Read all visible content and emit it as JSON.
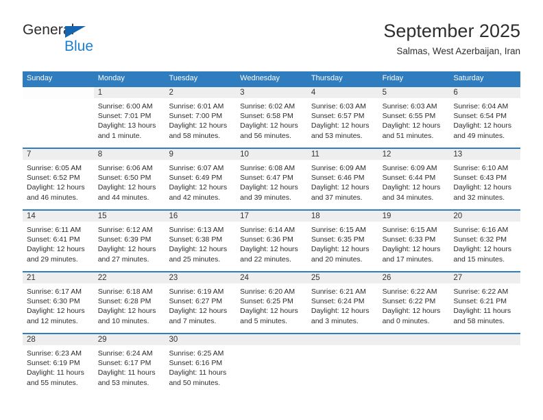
{
  "brand": {
    "name_part1": "General",
    "name_part2": "Blue",
    "triangle_icon": "triangle-icon",
    "color_dark": "#2b2b2b",
    "color_blue": "#1a7fd4"
  },
  "header": {
    "title": "September 2025",
    "subtitle": "Salmas, West Azerbaijan, Iran"
  },
  "theme": {
    "header_bg": "#2f7cbf",
    "header_text": "#ffffff",
    "daynum_band_bg": "#eeeeee",
    "row_divider": "#2f7cbf",
    "body_text": "#2b2b2b"
  },
  "calendar": {
    "day_names": [
      "Sunday",
      "Monday",
      "Tuesday",
      "Wednesday",
      "Thursday",
      "Friday",
      "Saturday"
    ],
    "labels": {
      "sunrise": "Sunrise:",
      "sunset": "Sunset:",
      "daylight": "Daylight:"
    },
    "weeks": [
      [
        {
          "day": ""
        },
        {
          "day": "1",
          "sunrise": "Sunrise: 6:00 AM",
          "sunset": "Sunset: 7:01 PM",
          "daylight_l1": "Daylight: 13 hours",
          "daylight_l2": "and 1 minute."
        },
        {
          "day": "2",
          "sunrise": "Sunrise: 6:01 AM",
          "sunset": "Sunset: 7:00 PM",
          "daylight_l1": "Daylight: 12 hours",
          "daylight_l2": "and 58 minutes."
        },
        {
          "day": "3",
          "sunrise": "Sunrise: 6:02 AM",
          "sunset": "Sunset: 6:58 PM",
          "daylight_l1": "Daylight: 12 hours",
          "daylight_l2": "and 56 minutes."
        },
        {
          "day": "4",
          "sunrise": "Sunrise: 6:03 AM",
          "sunset": "Sunset: 6:57 PM",
          "daylight_l1": "Daylight: 12 hours",
          "daylight_l2": "and 53 minutes."
        },
        {
          "day": "5",
          "sunrise": "Sunrise: 6:03 AM",
          "sunset": "Sunset: 6:55 PM",
          "daylight_l1": "Daylight: 12 hours",
          "daylight_l2": "and 51 minutes."
        },
        {
          "day": "6",
          "sunrise": "Sunrise: 6:04 AM",
          "sunset": "Sunset: 6:54 PM",
          "daylight_l1": "Daylight: 12 hours",
          "daylight_l2": "and 49 minutes."
        }
      ],
      [
        {
          "day": "7",
          "sunrise": "Sunrise: 6:05 AM",
          "sunset": "Sunset: 6:52 PM",
          "daylight_l1": "Daylight: 12 hours",
          "daylight_l2": "and 46 minutes."
        },
        {
          "day": "8",
          "sunrise": "Sunrise: 6:06 AM",
          "sunset": "Sunset: 6:50 PM",
          "daylight_l1": "Daylight: 12 hours",
          "daylight_l2": "and 44 minutes."
        },
        {
          "day": "9",
          "sunrise": "Sunrise: 6:07 AM",
          "sunset": "Sunset: 6:49 PM",
          "daylight_l1": "Daylight: 12 hours",
          "daylight_l2": "and 42 minutes."
        },
        {
          "day": "10",
          "sunrise": "Sunrise: 6:08 AM",
          "sunset": "Sunset: 6:47 PM",
          "daylight_l1": "Daylight: 12 hours",
          "daylight_l2": "and 39 minutes."
        },
        {
          "day": "11",
          "sunrise": "Sunrise: 6:09 AM",
          "sunset": "Sunset: 6:46 PM",
          "daylight_l1": "Daylight: 12 hours",
          "daylight_l2": "and 37 minutes."
        },
        {
          "day": "12",
          "sunrise": "Sunrise: 6:09 AM",
          "sunset": "Sunset: 6:44 PM",
          "daylight_l1": "Daylight: 12 hours",
          "daylight_l2": "and 34 minutes."
        },
        {
          "day": "13",
          "sunrise": "Sunrise: 6:10 AM",
          "sunset": "Sunset: 6:43 PM",
          "daylight_l1": "Daylight: 12 hours",
          "daylight_l2": "and 32 minutes."
        }
      ],
      [
        {
          "day": "14",
          "sunrise": "Sunrise: 6:11 AM",
          "sunset": "Sunset: 6:41 PM",
          "daylight_l1": "Daylight: 12 hours",
          "daylight_l2": "and 29 minutes."
        },
        {
          "day": "15",
          "sunrise": "Sunrise: 6:12 AM",
          "sunset": "Sunset: 6:39 PM",
          "daylight_l1": "Daylight: 12 hours",
          "daylight_l2": "and 27 minutes."
        },
        {
          "day": "16",
          "sunrise": "Sunrise: 6:13 AM",
          "sunset": "Sunset: 6:38 PM",
          "daylight_l1": "Daylight: 12 hours",
          "daylight_l2": "and 25 minutes."
        },
        {
          "day": "17",
          "sunrise": "Sunrise: 6:14 AM",
          "sunset": "Sunset: 6:36 PM",
          "daylight_l1": "Daylight: 12 hours",
          "daylight_l2": "and 22 minutes."
        },
        {
          "day": "18",
          "sunrise": "Sunrise: 6:15 AM",
          "sunset": "Sunset: 6:35 PM",
          "daylight_l1": "Daylight: 12 hours",
          "daylight_l2": "and 20 minutes."
        },
        {
          "day": "19",
          "sunrise": "Sunrise: 6:15 AM",
          "sunset": "Sunset: 6:33 PM",
          "daylight_l1": "Daylight: 12 hours",
          "daylight_l2": "and 17 minutes."
        },
        {
          "day": "20",
          "sunrise": "Sunrise: 6:16 AM",
          "sunset": "Sunset: 6:32 PM",
          "daylight_l1": "Daylight: 12 hours",
          "daylight_l2": "and 15 minutes."
        }
      ],
      [
        {
          "day": "21",
          "sunrise": "Sunrise: 6:17 AM",
          "sunset": "Sunset: 6:30 PM",
          "daylight_l1": "Daylight: 12 hours",
          "daylight_l2": "and 12 minutes."
        },
        {
          "day": "22",
          "sunrise": "Sunrise: 6:18 AM",
          "sunset": "Sunset: 6:28 PM",
          "daylight_l1": "Daylight: 12 hours",
          "daylight_l2": "and 10 minutes."
        },
        {
          "day": "23",
          "sunrise": "Sunrise: 6:19 AM",
          "sunset": "Sunset: 6:27 PM",
          "daylight_l1": "Daylight: 12 hours",
          "daylight_l2": "and 7 minutes."
        },
        {
          "day": "24",
          "sunrise": "Sunrise: 6:20 AM",
          "sunset": "Sunset: 6:25 PM",
          "daylight_l1": "Daylight: 12 hours",
          "daylight_l2": "and 5 minutes."
        },
        {
          "day": "25",
          "sunrise": "Sunrise: 6:21 AM",
          "sunset": "Sunset: 6:24 PM",
          "daylight_l1": "Daylight: 12 hours",
          "daylight_l2": "and 3 minutes."
        },
        {
          "day": "26",
          "sunrise": "Sunrise: 6:22 AM",
          "sunset": "Sunset: 6:22 PM",
          "daylight_l1": "Daylight: 12 hours",
          "daylight_l2": "and 0 minutes."
        },
        {
          "day": "27",
          "sunrise": "Sunrise: 6:22 AM",
          "sunset": "Sunset: 6:21 PM",
          "daylight_l1": "Daylight: 11 hours",
          "daylight_l2": "and 58 minutes."
        }
      ],
      [
        {
          "day": "28",
          "sunrise": "Sunrise: 6:23 AM",
          "sunset": "Sunset: 6:19 PM",
          "daylight_l1": "Daylight: 11 hours",
          "daylight_l2": "and 55 minutes."
        },
        {
          "day": "29",
          "sunrise": "Sunrise: 6:24 AM",
          "sunset": "Sunset: 6:17 PM",
          "daylight_l1": "Daylight: 11 hours",
          "daylight_l2": "and 53 minutes."
        },
        {
          "day": "30",
          "sunrise": "Sunrise: 6:25 AM",
          "sunset": "Sunset: 6:16 PM",
          "daylight_l1": "Daylight: 11 hours",
          "daylight_l2": "and 50 minutes."
        },
        {
          "day": ""
        },
        {
          "day": ""
        },
        {
          "day": ""
        },
        {
          "day": ""
        }
      ]
    ]
  }
}
